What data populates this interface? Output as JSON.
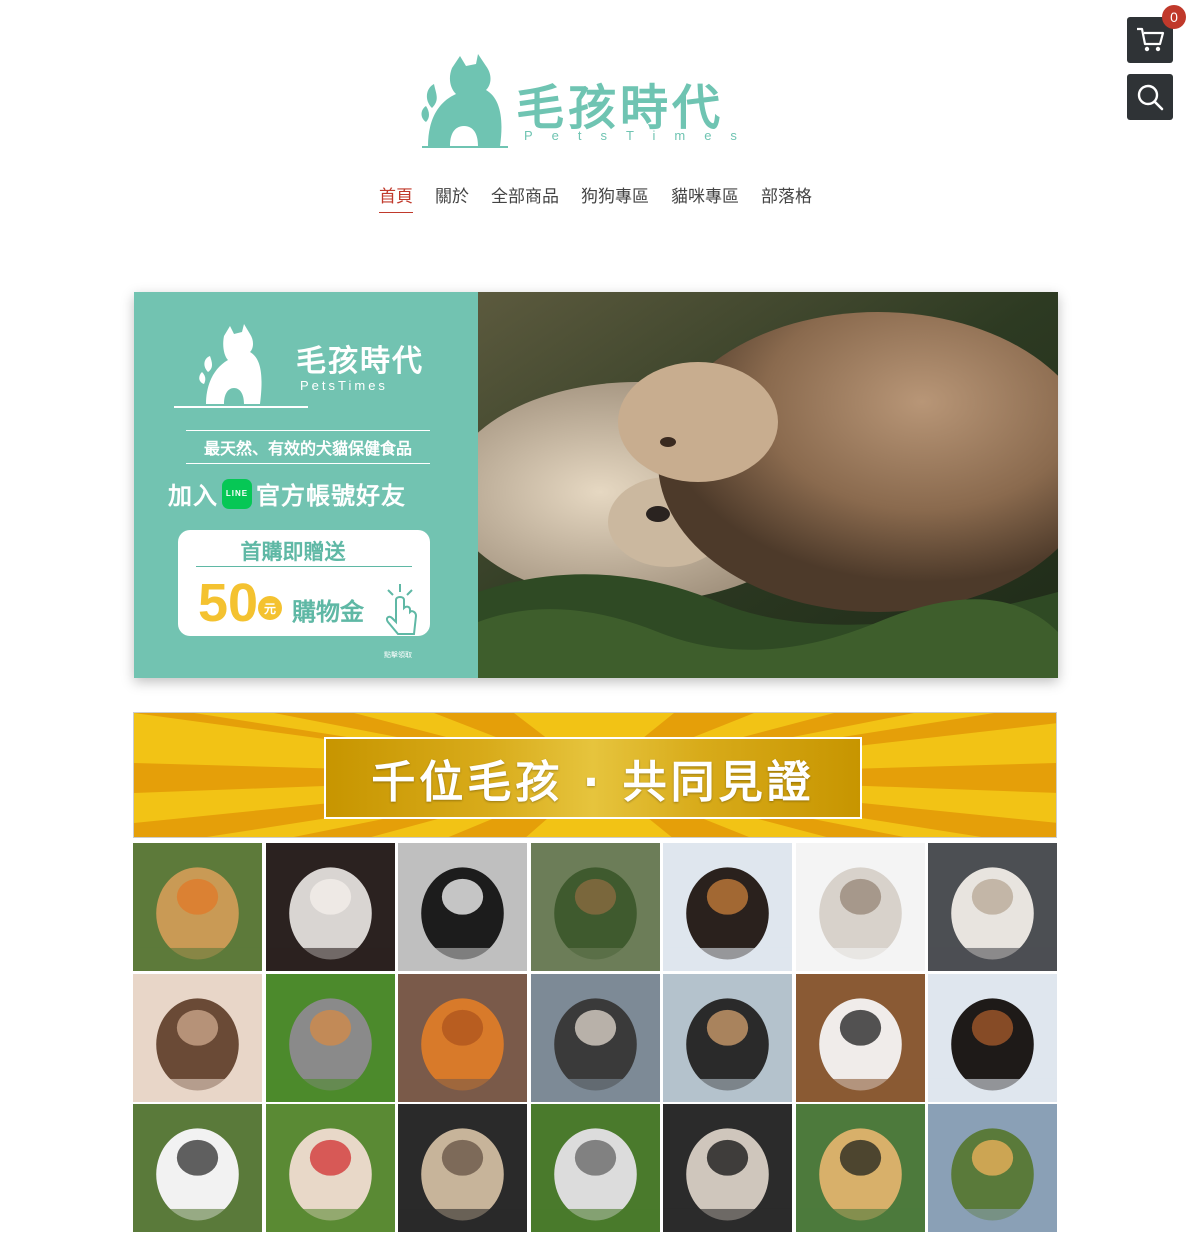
{
  "cart": {
    "count": "0",
    "icon": "cart-icon"
  },
  "search": {
    "icon": "search-icon"
  },
  "logo": {
    "title": "毛孩時代",
    "subtitle": "PetsTimes",
    "color": "#6fc4b2"
  },
  "nav": {
    "items": [
      {
        "label": "首頁",
        "active": true
      },
      {
        "label": "關於"
      },
      {
        "label": "全部商品"
      },
      {
        "label": "狗狗專區"
      },
      {
        "label": "貓咪專區"
      },
      {
        "label": "部落格"
      }
    ],
    "active_color": "#c0392b"
  },
  "hero": {
    "brand": "毛孩時代",
    "brand_sub": "PetsTimes",
    "tagline": "最天然、有效的犬貓保健食品",
    "join_prefix": "加入",
    "line_badge": "LINE",
    "join_suffix": "官方帳號好友",
    "coupon_title": "首購即贈送",
    "coupon_amount": "50",
    "coupon_unit": "元",
    "coupon_label": "購物金",
    "click_text": "點擊領取",
    "panel_color": "#72c3b1"
  },
  "testimonial": {
    "title": "千位毛孩 · 共同見證"
  },
  "gallery": {
    "tiles": [
      "dogs-in-flowers",
      "white-kitten",
      "black-dog",
      "small-dog-on-grass",
      "collie-with-ball",
      "cat-lying",
      "fluffy-cat",
      "cat-paws",
      "kittens-group",
      "orange-cat",
      "dog-on-boat",
      "person-with-dog-by-lake",
      "shouting-cat",
      "bernese-dog",
      "french-bulldog",
      "puppy-in-cup",
      "smiling-dog",
      "cat-in-grass",
      "cat-behind-door",
      "cheetah",
      "dog-on-mountain"
    ]
  }
}
